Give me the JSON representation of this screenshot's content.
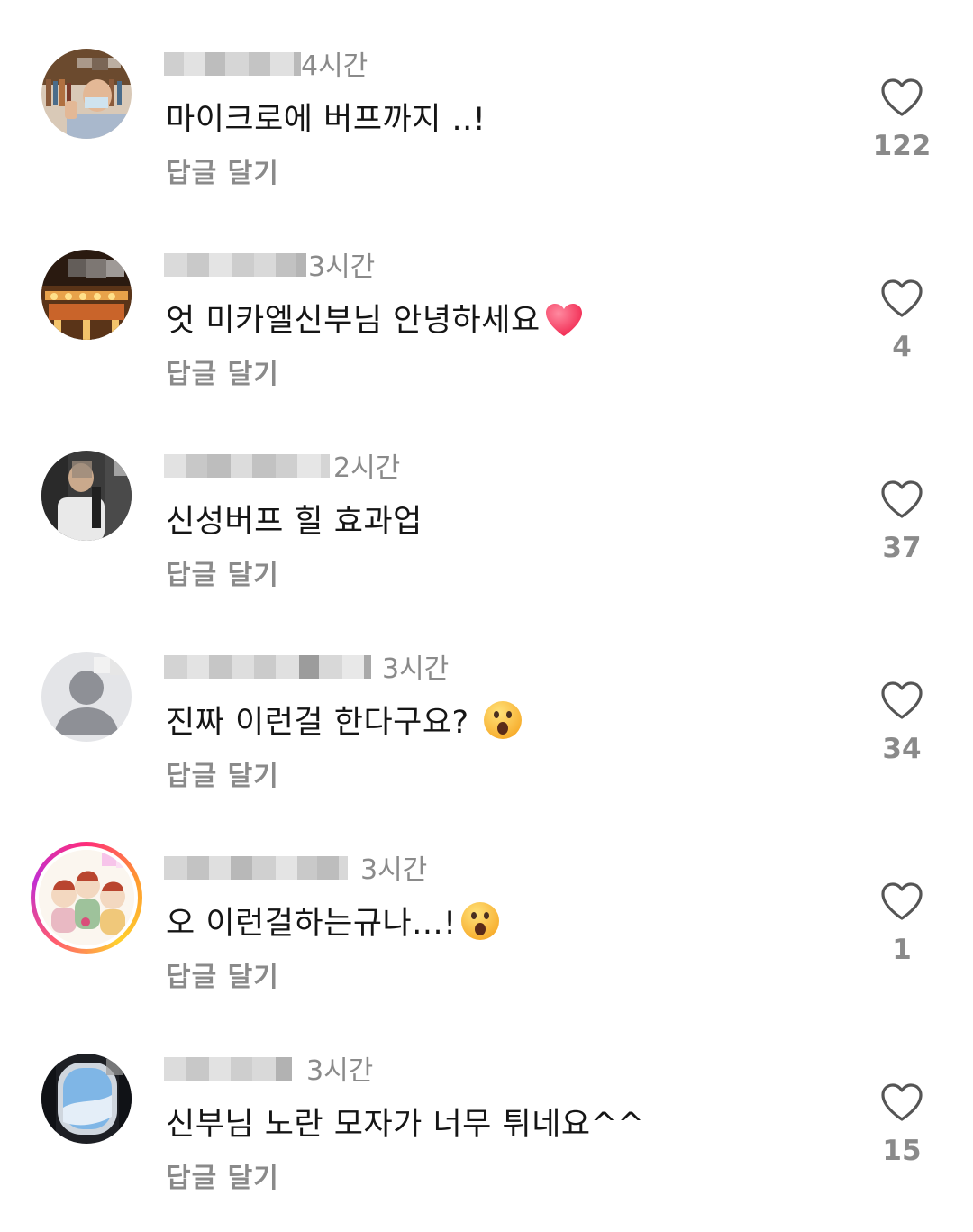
{
  "reply_label": "답글 달기",
  "like_icon": "heart-outline-icon",
  "colors": {
    "text": "#151515",
    "muted": "#8a8a8a",
    "story_ring": "#ff2d7a"
  },
  "comments": [
    {
      "time": "4시간",
      "text": "마이크로에 버프까지 ..!",
      "emoji": "",
      "likes": "122"
    },
    {
      "time": "3시간",
      "text": "엇 미카엘신부님 안녕하세요",
      "emoji": "heart",
      "likes": "4"
    },
    {
      "time": "2시간",
      "text": "신성버프 힐 효과업",
      "emoji": "",
      "likes": "37"
    },
    {
      "time": "3시간",
      "text": "진짜 이런걸 한다구요? ",
      "emoji": "surprised",
      "likes": "34"
    },
    {
      "time": "3시간",
      "text": "오 이런걸하는규나...!",
      "emoji": "surprised",
      "likes": "1"
    },
    {
      "time": "3시간",
      "text": "신부님 노란 모자가 너무 튀네요^^",
      "emoji": "",
      "likes": "15"
    }
  ]
}
